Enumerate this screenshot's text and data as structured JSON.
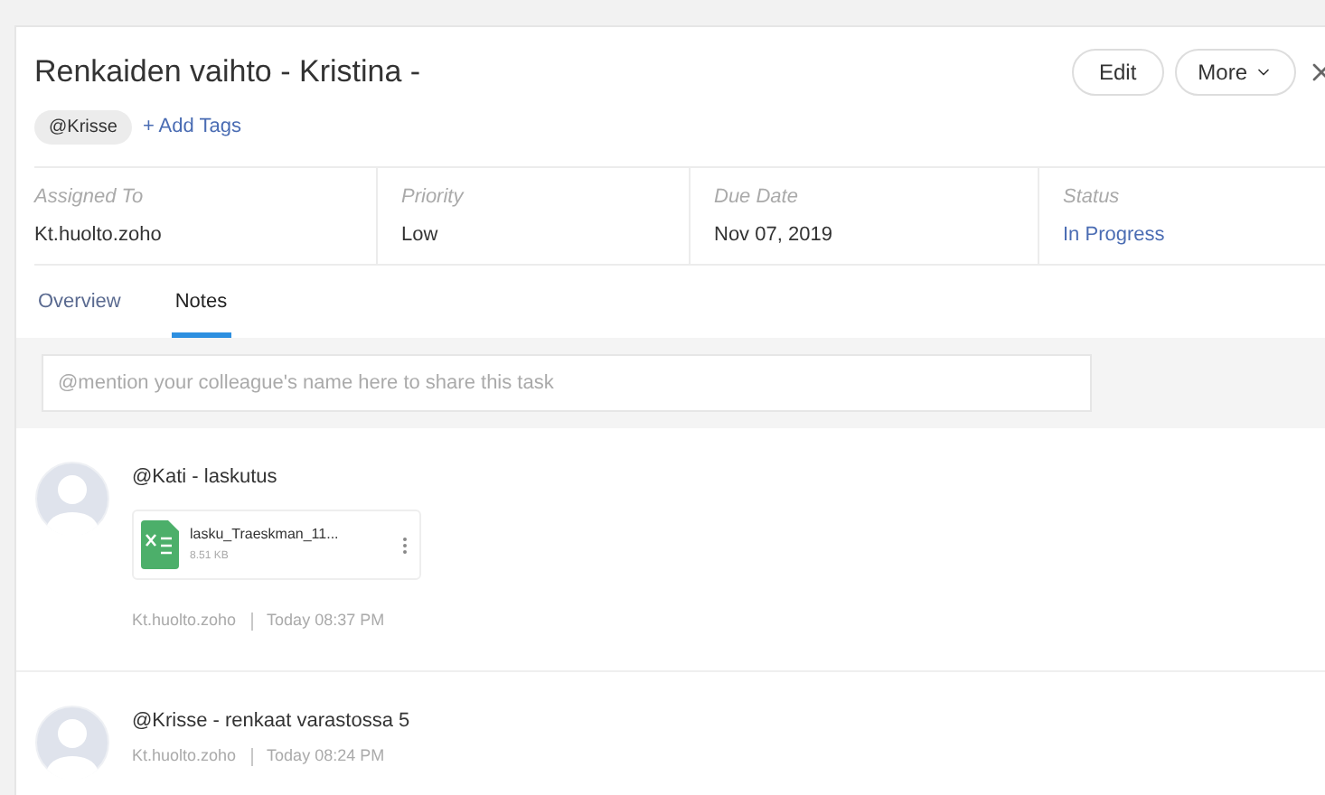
{
  "task": {
    "title": "Renkaiden vaihto - Kristina -",
    "tags": [
      "@Krisse"
    ],
    "add_tags": "+ Add Tags"
  },
  "buttons": {
    "edit": "Edit",
    "more": "More"
  },
  "details": [
    {
      "label": "Assigned To",
      "value": "Kt.huolto.zoho",
      "kind": "plain"
    },
    {
      "label": "Priority",
      "value": "Low",
      "kind": "plain"
    },
    {
      "label": "Due Date",
      "value": "Nov 07, 2019",
      "kind": "plain"
    },
    {
      "label": "Status",
      "value": "In Progress",
      "kind": "status"
    }
  ],
  "tabs": [
    {
      "label": "Overview",
      "selected": false
    },
    {
      "label": "Notes",
      "selected": true
    }
  ],
  "comment": {
    "placeholder": "@mention your colleague's name here to share this task"
  },
  "notes": [
    {
      "text": "@Kati - laskutus",
      "attachment": {
        "name": "lasku_Traeskman_11...",
        "size": "8.51 KB"
      },
      "author": "Kt.huolto.zoho",
      "time": "Today 08:37 PM"
    },
    {
      "text": "@Krisse - renkaat varastossa 5",
      "author": "Kt.huolto.zoho",
      "time": "Today 08:24 PM"
    }
  ]
}
